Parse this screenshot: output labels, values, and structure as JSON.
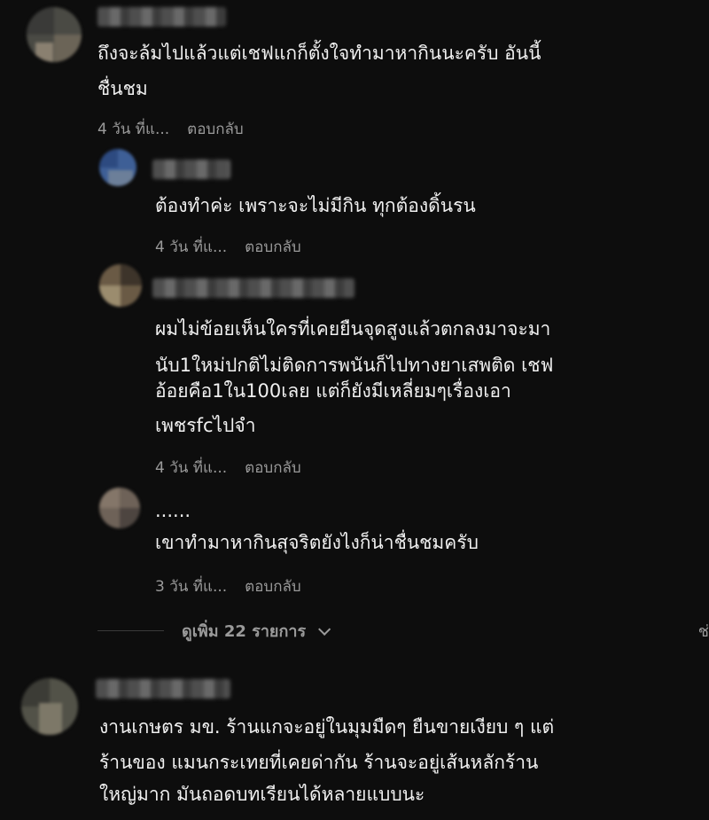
{
  "comments": [
    {
      "text_lines": [
        "ถึงจะล้มไปแล้วแต่เชฟแกก็ตั้งใจทำมาหากินนะครับ อันนี้",
        "ชื่นชม"
      ],
      "time": "4 วัน ที่แ...",
      "reply": "ตอบกลับ"
    },
    {
      "text_lines": [
        "ต้องทำค่ะ เพราะจะไม่มีกิน ทุกต้องดิ้นรน"
      ],
      "time": "4 วัน ที่แ...",
      "reply": "ตอบกลับ"
    },
    {
      "text_lines": [
        "ผมไม่ข้อยเห็นใครที่เคยยืนจุดสูงแล้วตกลงมาจะมา",
        "นับ1ใหม่ปกติไม่ติดการพนันก็ไปทางยาเสพติด เชฟ",
        "อ้อยคือ1ใน100เลย แต่ก็ยังมีเหลี่ยมๆเรื่องเอา",
        "เพชรfcไปจำ"
      ],
      "time": "4 วัน ที่แ...",
      "reply": "ตอบกลับ"
    },
    {
      "name": "......",
      "text_lines": [
        "เขาทำมาหากินสุจริตยังไงก็น่าชื่นชมครับ"
      ],
      "time": "3 วัน ที่แ...",
      "reply": "ตอบกลับ"
    },
    {
      "text_lines": [
        "งานเกษตร มข. ร้านแกจะอยู่ในมุมมืดๆ ยืนขายเงียบ ๆ แต่",
        "ร้านของ แมนกระเทยที่เคยด่ากัน ร้านจะอยู่เส้นหลักร้าน",
        "ใหญ่มาก มันถอดบทเรียนได้หลายแบบนะ"
      ]
    }
  ],
  "more_replies": "ดูเพิ่ม 22 รายการ",
  "edge_text": "ช่"
}
